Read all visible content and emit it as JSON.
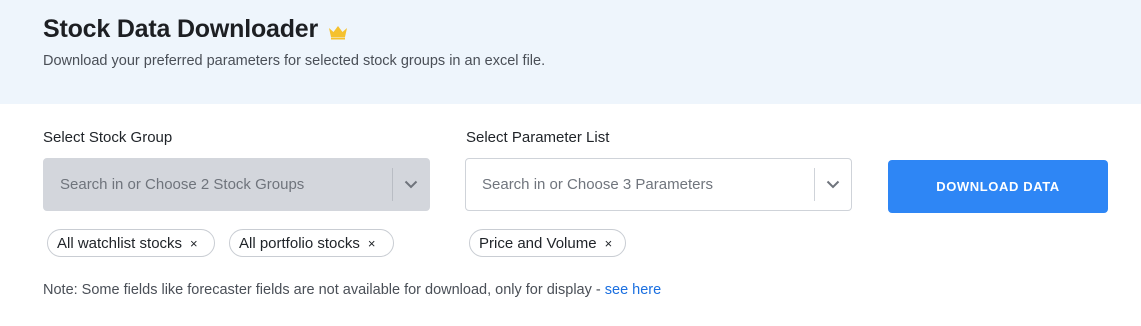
{
  "header": {
    "title": "Stock Data Downloader",
    "crown_icon": "crown-icon",
    "subtitle": "Download your preferred parameters for selected stock groups in an excel file."
  },
  "stock_group": {
    "label": "Select Stock Group",
    "placeholder": "Search in or Choose 2 Stock Groups",
    "chips": [
      {
        "label": "All watchlist stocks",
        "close": "×"
      },
      {
        "label": "All portfolio stocks",
        "close": "×"
      }
    ]
  },
  "parameter_list": {
    "label": "Select Parameter List",
    "placeholder": "Search in or Choose 3 Parameters",
    "chips": [
      {
        "label": "Price and Volume",
        "close": "×"
      }
    ]
  },
  "download_button": {
    "label": "DOWNLOAD DATA"
  },
  "note": {
    "text": "Note: Some fields like forecaster fields are not available for download, only for display - ",
    "link": "see here"
  },
  "colors": {
    "header_bg": "#eef5fc",
    "accent": "#2e86f5",
    "link": "#1a6fe0",
    "crown": "#f5c12e",
    "disabled_select_bg": "#d3d6dc"
  }
}
